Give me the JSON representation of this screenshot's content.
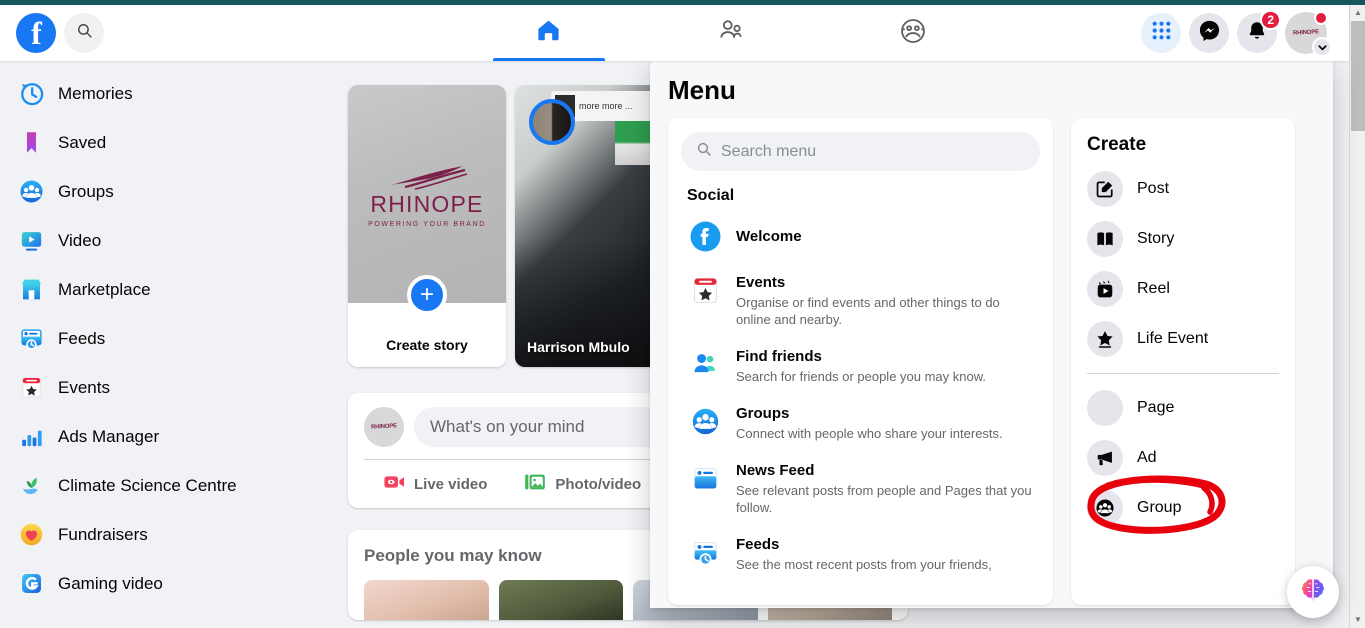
{
  "topbar": {
    "logo_icon": "facebook-logo-icon",
    "search_icon": "search-icon",
    "tabs": [
      {
        "name": "home",
        "icon": "home-icon",
        "active": true
      },
      {
        "name": "friends",
        "icon": "friends-icon",
        "active": false
      },
      {
        "name": "gaming",
        "icon": "gaming-controller-icon",
        "active": false
      }
    ],
    "menu_grid_icon": "grid-menu-icon",
    "messenger_icon": "messenger-icon",
    "notifications_icon": "bell-icon",
    "notifications_count": "2",
    "avatar_label": "RHINOPE",
    "chevron_icon": "chevron-down-icon"
  },
  "sidebar": {
    "items": [
      {
        "label": "Memories",
        "icon": "clock-memories-icon"
      },
      {
        "label": "Saved",
        "icon": "bookmark-icon"
      },
      {
        "label": "Groups",
        "icon": "groups-icon"
      },
      {
        "label": "Video",
        "icon": "video-icon"
      },
      {
        "label": "Marketplace",
        "icon": "marketplace-icon"
      },
      {
        "label": "Feeds",
        "icon": "feeds-icon"
      },
      {
        "label": "Events",
        "icon": "events-calendar-icon"
      },
      {
        "label": "Ads Manager",
        "icon": "ads-manager-bars-icon"
      },
      {
        "label": "Climate Science Centre",
        "icon": "climate-plant-icon"
      },
      {
        "label": "Fundraisers",
        "icon": "fundraisers-heart-icon"
      },
      {
        "label": "Gaming video",
        "icon": "gaming-video-icon"
      }
    ]
  },
  "feed": {
    "stories": [
      {
        "type": "create",
        "label": "Create story",
        "brand_name": "RHINOPE",
        "brand_tagline": "POWERING YOUR BRAND",
        "plus_icon": "plus-icon"
      },
      {
        "type": "story",
        "name": "Harrison Mbulo",
        "tag_text": "more more ..."
      }
    ],
    "composer": {
      "placeholder": "What's on your mind",
      "actions": [
        {
          "label": "Live video",
          "icon": "live-video-icon"
        },
        {
          "label": "Photo/video",
          "icon": "photo-video-icon"
        }
      ]
    },
    "people_you_may_know": {
      "title": "People you may know"
    }
  },
  "menu": {
    "title": "Menu",
    "search_placeholder": "Search menu",
    "search_icon": "search-icon",
    "section_title": "Social",
    "items": [
      {
        "label": "Welcome",
        "desc": "",
        "icon": "facebook-welcome-icon"
      },
      {
        "label": "Events",
        "desc": "Organise or find events and other things to do online and nearby.",
        "icon": "events-calendar-icon"
      },
      {
        "label": "Find friends",
        "desc": "Search for friends or people you may know.",
        "icon": "find-friends-icon"
      },
      {
        "label": "Groups",
        "desc": "Connect with people who share your interests.",
        "icon": "groups-icon"
      },
      {
        "label": "News Feed",
        "desc": "See relevant posts from people and Pages that you follow.",
        "icon": "news-feed-icon"
      },
      {
        "label": "Feeds",
        "desc": "See the most recent posts from your friends,",
        "icon": "feeds-icon"
      }
    ],
    "create": {
      "title": "Create",
      "items": [
        {
          "label": "Post",
          "icon": "post-pencil-icon",
          "annotated": false
        },
        {
          "label": "Story",
          "icon": "story-book-icon",
          "annotated": false
        },
        {
          "label": "Reel",
          "icon": "reel-clapper-icon",
          "annotated": false
        },
        {
          "label": "Life Event",
          "icon": "life-event-star-icon",
          "annotated": false
        },
        {
          "label": "Page",
          "icon": "page-flag-icon",
          "annotated": false
        },
        {
          "label": "Ad",
          "icon": "ad-megaphone-icon",
          "annotated": true
        },
        {
          "label": "Group",
          "icon": "group-people-icon",
          "annotated": false
        }
      ]
    }
  },
  "widgets": {
    "ai_assistant_icon": "ai-brain-icon"
  },
  "colors": {
    "brand_blue": "#1877f2",
    "badge_red": "#e41e3f",
    "annotation_red": "#e8000d",
    "page_bg": "#f0f2f5",
    "browser_strip": "#16585e"
  }
}
